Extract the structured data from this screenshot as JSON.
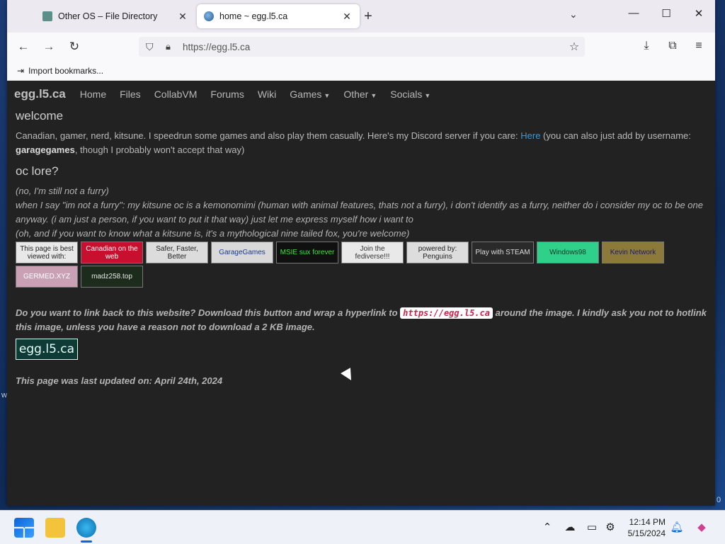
{
  "desktop": {
    "edge_text_left": "w",
    "edge_text_right": "0"
  },
  "browser": {
    "tabs": [
      {
        "title": "Other OS – File Directory",
        "close": "✕",
        "active": false
      },
      {
        "title": "home ~ egg.l5.ca",
        "close": "✕",
        "active": true
      }
    ],
    "new_tab_icon": "+",
    "tab_list_icon": "⌄",
    "window_controls": {
      "minimize": "—",
      "maximize": "☐",
      "close": "✕"
    },
    "nav": {
      "back": "←",
      "forward": "→",
      "reload": "↻"
    },
    "url": "https://egg.l5.ca",
    "bookmarks": {
      "import_label": "Import bookmarks..."
    }
  },
  "site": {
    "brand": "egg.l5.ca",
    "nav_links": [
      "Home",
      "Files",
      "CollabVM",
      "Forums",
      "Wiki"
    ],
    "nav_dropdowns": [
      "Games",
      "Other",
      "Socials"
    ],
    "welcome_heading": "welcome",
    "intro_text": "Canadian, gamer, nerd, kitsune. I speedrun some games and also play them casually. Here's my Discord server if you care: ",
    "intro_link": "Here",
    "intro_text_2": " (you can also just add by username: ",
    "intro_username": "garagegames",
    "intro_text_3": ", though I probably won't accept that way)",
    "lore_heading": "oc lore?",
    "lore_lines": [
      "(no, I'm still not a furry)",
      "when I say \"im not a furry\": my kitsune oc is a kemonomimi (human with animal features, thats not a furry), i don't identify as a furry, neither do i consider my oc to be one anyway. (i am just a person, if you want to put it that way) just let me express myself how i want to",
      "(oh, and if you want to know what a kitsune is, it's a mythological nine tailed fox, you're welcome)"
    ],
    "badges": [
      {
        "text": "This page is best viewed with:",
        "bg": "#e8e8e8",
        "fg": "#222222"
      },
      {
        "text": "Canadian on the web",
        "bg": "#c8102e",
        "fg": "#ffffff"
      },
      {
        "text": "Safer, Faster, Better",
        "bg": "#dcdcdc",
        "fg": "#222222"
      },
      {
        "text": "GarageGames",
        "bg": "#d9d9d9",
        "fg": "#1a3a8a"
      },
      {
        "text": "MSIE sux forever",
        "bg": "#101010",
        "fg": "#39e639"
      },
      {
        "text": "Join the fediverse!!!",
        "bg": "#e9e9e9",
        "fg": "#333333"
      },
      {
        "text": "powered by: Penguins",
        "bg": "#dddddd",
        "fg": "#222222"
      },
      {
        "text": "Play with STEAM",
        "bg": "#2a2a2a",
        "fg": "#dddddd"
      },
      {
        "text": "Windows98",
        "bg": "#2fd08a",
        "fg": "#0b3b22"
      },
      {
        "text": "Kevin Network",
        "bg": "#8b7a3a",
        "fg": "#1b1b6b"
      },
      {
        "text": "GERMED.XYZ",
        "bg": "#c9a0b4",
        "fg": "#ffffff"
      },
      {
        "text": "madz258.top",
        "bg": "#1c2b1c",
        "fg": "#e6e6e6"
      }
    ],
    "linkback_text_1": "Do you want to link back to this website? Download this button and wrap a hyperlink to ",
    "linkback_code": "https://egg.l5.ca",
    "linkback_text_2": " around the image. I kindly ask you not to hotlink this image, unless you have a reason not to download a 2 KB image.",
    "button_image_text": "egg.l5.ca",
    "updated_text": "This page was last updated on: April 24th, 2024"
  },
  "taskbar": {
    "time": "12:14 PM",
    "date": "5/15/2024",
    "tray_icons": [
      "chevron-up-icon",
      "cloud-off-icon",
      "devices-icon",
      "network-settings-icon",
      "bell-icon",
      "copilot-icon"
    ]
  }
}
